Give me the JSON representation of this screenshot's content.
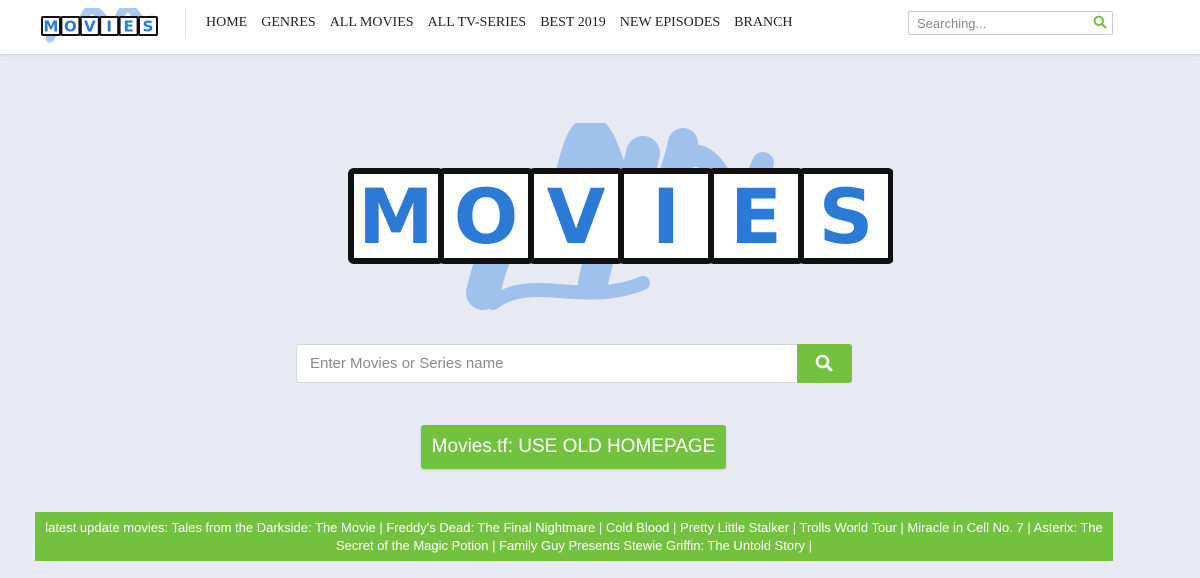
{
  "brand": {
    "logo_letters": [
      "M",
      "O",
      "V",
      "I",
      "E",
      "S"
    ],
    "logo_fill_color": "#2b7bd6",
    "logo_splash_color": "#8db7ea"
  },
  "nav": {
    "items": [
      {
        "label": "HOME"
      },
      {
        "label": "GENRES"
      },
      {
        "label": "ALL MOVIES"
      },
      {
        "label": "ALL TV-SERIES"
      },
      {
        "label": "BEST 2019"
      },
      {
        "label": "NEW EPISODES"
      },
      {
        "label": "BRANCH"
      }
    ]
  },
  "top_search": {
    "placeholder": "Searching...",
    "icon": "search-icon"
  },
  "main_search": {
    "placeholder": "Enter Movies or Series name",
    "button_icon": "search-icon"
  },
  "old_homepage_button": {
    "label": "Movies.tf: USE OLD HOMEPAGE"
  },
  "latest_updates": {
    "prefix": "latest update movies: ",
    "items": [
      "Tales from the Darkside: The Movie",
      "Freddy's Dead: The Final Nightmare",
      "Cold Blood",
      "Pretty Little Stalker",
      "Trolls World Tour",
      "Miracle in Cell No. 7",
      "Asterix: The Secret of the Magic Potion",
      "Family Guy Presents Stewie Griffin: The Untold Story"
    ],
    "separator": " | "
  },
  "colors": {
    "accent_green": "#72c23f",
    "page_background": "#e8eaf3",
    "topbar_background": "#ffffff"
  }
}
